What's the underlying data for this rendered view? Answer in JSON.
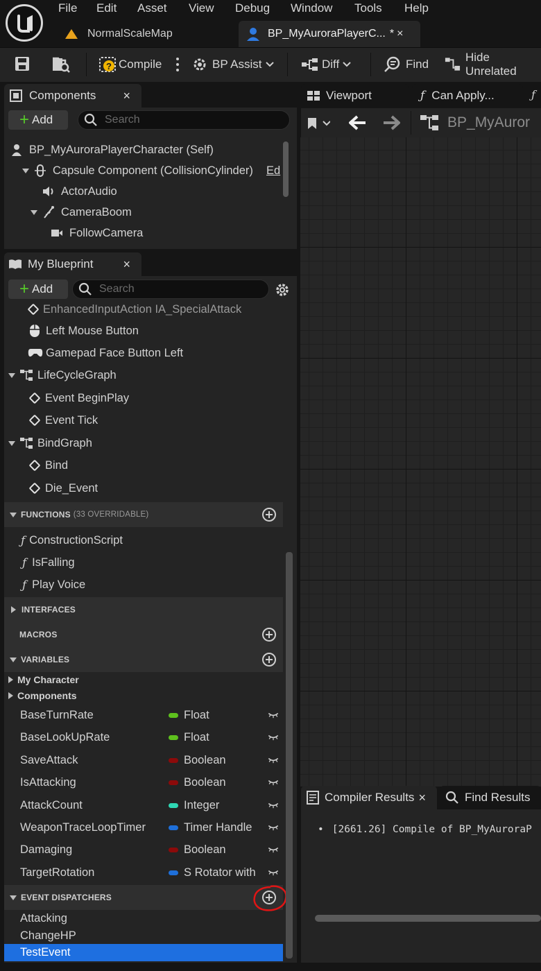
{
  "menu": [
    "File",
    "Edit",
    "Asset",
    "View",
    "Debug",
    "Window",
    "Tools",
    "Help"
  ],
  "tabs": {
    "map": "NormalScaleMap",
    "blueprint": "BP_MyAuroraPlayerC...",
    "blueprint_mark": "*",
    "close": "×"
  },
  "toolbar": {
    "compile": "Compile",
    "bp_assist": "BP Assist",
    "diff": "Diff",
    "find": "Find",
    "hide_unrelated": "Hide Unrelated"
  },
  "components": {
    "tab": "Components",
    "close": "×",
    "add": "Add",
    "search_placeholder": "Search",
    "tree": {
      "self": "BP_MyAuroraPlayerCharacter (Self)",
      "capsule": "Capsule Component (CollisionCylinder)",
      "capsule_edit": "Ed",
      "actor_audio": "ActorAudio",
      "camera_boom": "CameraBoom",
      "follow_camera": "FollowCamera"
    }
  },
  "my_blueprint": {
    "tab": "My Blueprint",
    "close": "×",
    "add": "Add",
    "search_placeholder": "Search",
    "graph_items": {
      "cut_item": "EnhancedInputAction IA_SpecialAttack",
      "left_mouse": "Left Mouse Button",
      "gamepad": "Gamepad Face Button Left",
      "lifecycle_graph": "LifeCycleGraph",
      "begin_play": "Event BeginPlay",
      "tick": "Event Tick",
      "bind_graph": "BindGraph",
      "bind": "Bind",
      "die_event": "Die_Event"
    },
    "functions": {
      "header": "FUNCTIONS",
      "overridable": "(33 OVERRIDABLE)",
      "items": [
        "ConstructionScript",
        "IsFalling",
        "Play Voice"
      ]
    },
    "interfaces_header": "INTERFACES",
    "macros_header": "MACROS",
    "variables": {
      "header": "VARIABLES",
      "categories": [
        "My Character",
        "Components"
      ],
      "items": [
        {
          "name": "BaseTurnRate",
          "type": "Float",
          "color": "#5ec01d"
        },
        {
          "name": "BaseLookUpRate",
          "type": "Float",
          "color": "#5ec01d"
        },
        {
          "name": "SaveAttack",
          "type": "Boolean",
          "color": "#8c0a0a"
        },
        {
          "name": "IsAttacking",
          "type": "Boolean",
          "color": "#8c0a0a"
        },
        {
          "name": "AttackCount",
          "type": "Integer",
          "color": "#2fd7b4"
        },
        {
          "name": "WeaponTraceLoopTimer",
          "type": "Timer Handle",
          "color": "#1e6fd9"
        },
        {
          "name": "Damaging",
          "type": "Boolean",
          "color": "#8c0a0a"
        },
        {
          "name": "TargetRotation",
          "type": "S Rotator with",
          "color": "#1e6fd9"
        }
      ]
    },
    "event_dispatchers": {
      "header": "EVENT DISPATCHERS",
      "items": [
        "Attacking",
        "ChangeHP",
        "TestEvent"
      ]
    }
  },
  "graph_tabs": {
    "viewport": "Viewport",
    "can_apply": "Can Apply...",
    "breadcrumb": "BP_MyAuror"
  },
  "bottom": {
    "compiler_results": "Compiler Results",
    "close": "×",
    "find_results": "Find Results",
    "log_line": "[2661.26] Compile of BP_MyAuroraP"
  },
  "colors": {
    "selection": "#1e6fe0",
    "annotation": "#e01515"
  }
}
